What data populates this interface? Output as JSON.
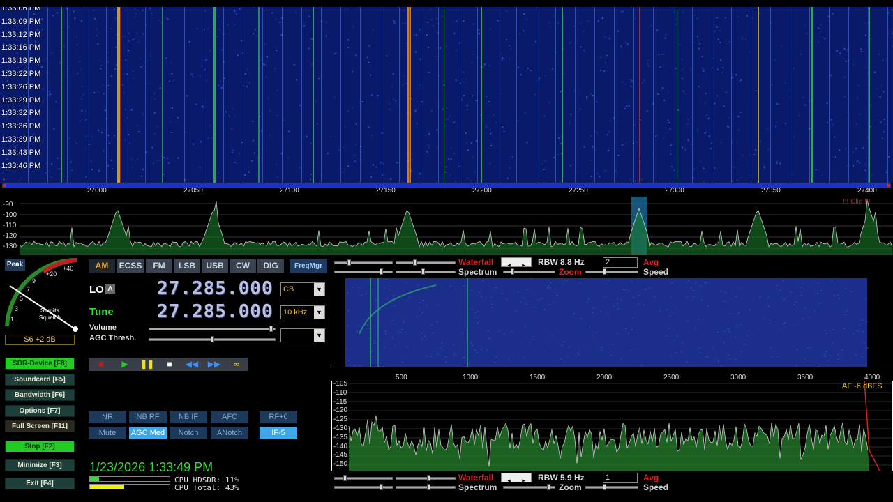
{
  "waterfall": {
    "time_labels": [
      "1:33:06 PM",
      "1:33:09 PM",
      "1:33:12 PM",
      "1:33:16 PM",
      "1:33:19 PM",
      "1:33:22 PM",
      "1:33:26 PM",
      "1:33:29 PM",
      "1:33:32 PM",
      "1:33:36 PM",
      "1:33:39 PM",
      "1:33:43 PM",
      "1:33:46 PM"
    ],
    "freq_ticks": [
      "27000",
      "27050",
      "27100",
      "27150",
      "27200",
      "27250",
      "27300",
      "27350",
      "27400"
    ]
  },
  "spectrum": {
    "db_ticks": [
      "-90",
      "-100",
      "-110",
      "-120",
      "-130"
    ],
    "clip_label": "!!! Clip !!!"
  },
  "meter": {
    "peak_label": "Peak",
    "scale_labels": [
      "+40",
      "+20",
      "9",
      "7",
      "5",
      "3",
      "1"
    ],
    "units_label": "S-units",
    "squelch_label": "Squelch",
    "readout": "S6 +2 dB"
  },
  "modes": {
    "items": [
      "AM",
      "ECSS",
      "FM",
      "LSB",
      "USB",
      "CW",
      "DIG"
    ],
    "active": "AM",
    "freqmgr": "FreqMgr"
  },
  "tuning": {
    "lo_label": "LO",
    "lo_badge": "A",
    "lo_freq": "27.285.000",
    "lo_band": "CB",
    "tune_label": "Tune",
    "tune_freq": "27.285.000",
    "tune_step": "10 kHz",
    "volume_label": "Volume",
    "agc_label": "AGC Thresh.",
    "volume_level": 0.98,
    "agc_level": 0.5
  },
  "left_buttons": {
    "sdr_device": "SDR-Device [F8]",
    "soundcard": "Soundcard [F5]",
    "bandwidth": "Bandwidth [F6]",
    "options": "Options [F7]",
    "full_screen": "Full Screen [F11]",
    "stop": "Stop [F2]",
    "minimize": "Minimize [F3]",
    "exit": "Exit [F4]"
  },
  "transport_icons": [
    "record-icon",
    "play-icon",
    "pause-icon",
    "stop-icon",
    "rewind-icon",
    "forward-icon",
    "loop-icon"
  ],
  "dsp": {
    "row1": [
      "NR",
      "NB RF",
      "NB IF",
      "AFC"
    ],
    "row2": [
      "Mute",
      "AGC Med",
      "Notch",
      "ANotch"
    ],
    "rf": "RF+0",
    "if": "IF-5",
    "active": [
      "AGC Med",
      "IF-5"
    ]
  },
  "status": {
    "datetime": "1/23/2026 1:33:49 PM",
    "cpu_hdsdr": "CPU HDSDR: 11%",
    "cpu_total": "CPU Total: 43%",
    "cpu_hdsdr_pct": 11,
    "cpu_total_pct": 43
  },
  "top_controls": {
    "waterfall": "Waterfall",
    "spectrum": "Spectrum",
    "zoom": "Zoom",
    "speed": "Speed",
    "rbw": "RBW  8.8 Hz",
    "avg_label": "Avg",
    "avg_value": "2"
  },
  "audio": {
    "freq_ticks": [
      "500",
      "1000",
      "1500",
      "2000",
      "2500",
      "3000",
      "3500",
      "4000"
    ],
    "db_ticks": [
      "-105",
      "-110",
      "-115",
      "-120",
      "-125",
      "-130",
      "-135",
      "-140",
      "-145",
      "-150"
    ],
    "af_label": "AF  -6 dBFS"
  },
  "bottom_controls": {
    "waterfall": "Waterfall",
    "spectrum": "Spectrum",
    "zoom": "Zoom",
    "speed": "Speed",
    "rbw": "RBW  5.9 Hz",
    "avg_label": "Avg",
    "avg_value": "1"
  },
  "colors": {
    "waterfall_bg": "#0a1a6a",
    "accent_green": "#22cc22",
    "mode_active": "#f0a030",
    "freq_text": "#b8c0e8"
  }
}
